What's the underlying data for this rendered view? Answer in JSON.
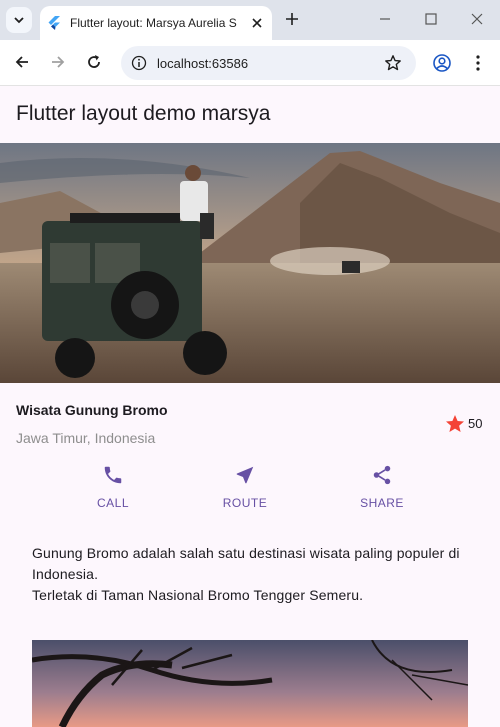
{
  "browser": {
    "tab_title": "Flutter layout: Marsya Aurelia S",
    "url": "localhost:63586"
  },
  "app": {
    "title": "Flutter layout demo marsya"
  },
  "place": {
    "name": "Wisata Gunung Bromo",
    "location": "Jawa Timur, Indonesia",
    "rating": "50"
  },
  "actions": [
    {
      "label": "CALL",
      "icon": "phone-icon"
    },
    {
      "label": "ROUTE",
      "icon": "navigation-icon"
    },
    {
      "label": "SHARE",
      "icon": "share-icon"
    }
  ],
  "description": {
    "line1": "Gunung Bromo adalah salah satu destinasi wisata paling populer di Indonesia.",
    "line2": "Terletak di Taman Nasional Bromo Tengger Semeru."
  },
  "colors": {
    "accent": "#6750a4",
    "star": "#f44336",
    "background": "#fdf7fd"
  }
}
